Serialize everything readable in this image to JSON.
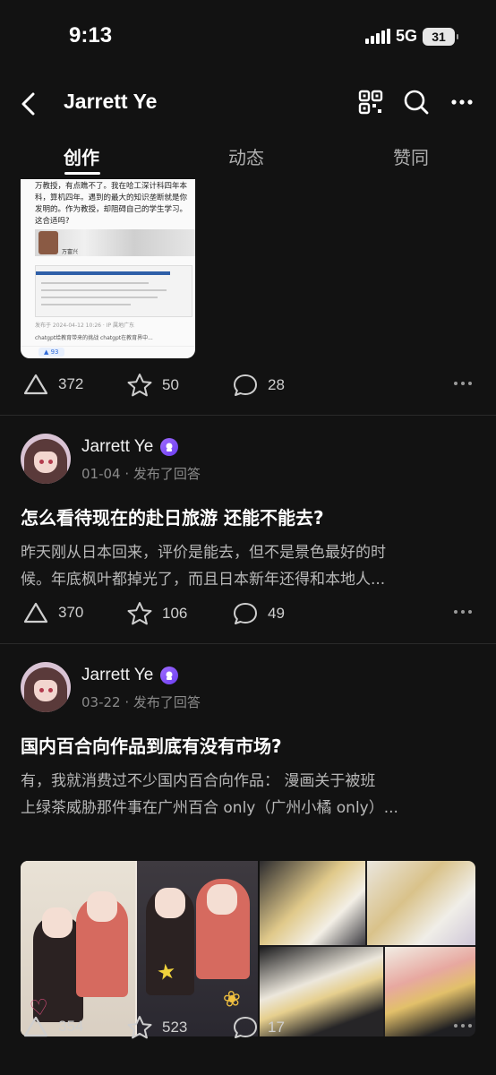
{
  "status_bar": {
    "time": "9:13",
    "network": "5G",
    "battery": "31"
  },
  "header": {
    "title": "Jarrett Ye"
  },
  "tabs": [
    {
      "label": "创作",
      "active": true
    },
    {
      "label": "动态",
      "active": false
    },
    {
      "label": "赞同",
      "active": false
    }
  ],
  "thumb1": {
    "text": "万教授，有点瞧不了。我在哈工深计科四年本科，算机四年。遇到的最大的知识垄断就是你发明的。作为教授，却阻碍自己的学生学习。这合适吗?",
    "name": "万富兴",
    "meta": "发布于 2024-04-12 10:26 · IP 属地广东",
    "chips": "chatgpt给教育带来的挑战   chatgpt在教育界中...",
    "votes": "▲ 93"
  },
  "posts": [
    {
      "likes": "372",
      "favorites": "50",
      "comments": "28"
    },
    {
      "author": "Jarrett Ye",
      "date": "01-04",
      "action": "发布了回答",
      "title": "怎么看待现在的赴日旅游 还能不能去?",
      "excerpt1": "昨天刚从日本回来，评价是能去，但不是景色最好的时",
      "excerpt2": "候。年底枫叶都掉光了，而且日本新年还得和本地人...",
      "likes": "370",
      "favorites": "106",
      "comments": "49"
    },
    {
      "author": "Jarrett Ye",
      "date": "03-22",
      "action": "发布了回答",
      "title": "国内百合向作品到底有没有市场?",
      "excerpt1": "有，我就消费过不少国内百合向作品： 漫画关于被班",
      "excerpt2": "上绿茶威胁那件事在广州百合 only（广州小橘 only）...",
      "likes": "354",
      "favorites": "523",
      "comments": "17"
    }
  ],
  "colors": {
    "background": "#121212",
    "text": "#ffffff",
    "muted": "#8a8a8a",
    "badge": "#8a55ff"
  }
}
